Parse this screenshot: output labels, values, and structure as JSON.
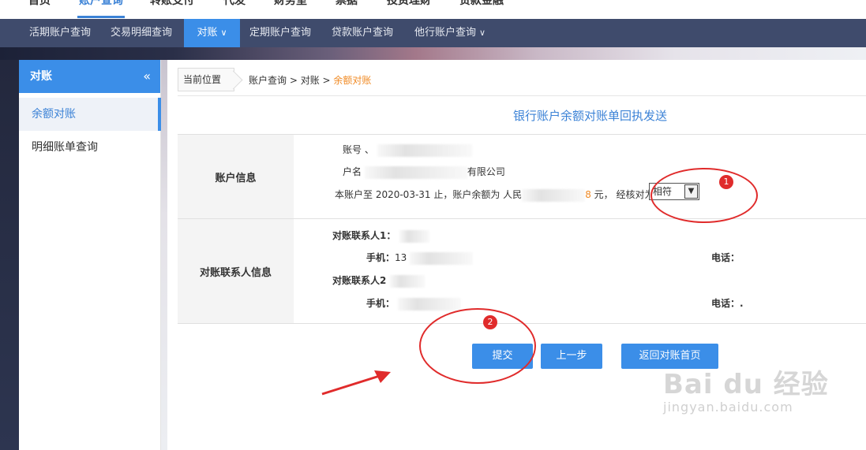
{
  "top_nav": {
    "items": [
      "首页",
      "账户查询",
      "转账支付",
      "代发",
      "财务室",
      "票据",
      "投资理财",
      "贷款金融"
    ],
    "active_index": 1
  },
  "sub_nav": {
    "items": [
      {
        "label": "活期账户查询"
      },
      {
        "label": "交易明细查询"
      },
      {
        "label": "对账",
        "has_dropdown": true,
        "active": true
      },
      {
        "label": "定期账户查询"
      },
      {
        "label": "贷款账户查询"
      },
      {
        "label": "他行账户查询",
        "has_dropdown": true
      }
    ]
  },
  "sidebar": {
    "title": "对账",
    "collapse_icon": "«",
    "items": [
      {
        "label": "余额对账",
        "active": true
      },
      {
        "label": "明细账单查询"
      }
    ]
  },
  "breadcrumb": {
    "here_label": "当前位置",
    "path": "账户查询 > 对账 > ",
    "current": "余额对账"
  },
  "page_title": "银行账户余额对账单回执发送",
  "account_info": {
    "label": "账户信息",
    "account_no_label": "账号",
    "account_no_prefix": "、",
    "name_label": "户名",
    "name_suffix": "有限公司",
    "statement_prefix": "本账户至 2020-03-31 止，账户余额为 人民",
    "balance_tail": "8",
    "statement_suffix": " 元， 经核对为",
    "match_value": "相符"
  },
  "contact_info": {
    "label": "对账联系人信息",
    "contact1_label": "对账联系人1：",
    "mobile_label": "手机：",
    "mobile1_prefix": "13",
    "phone_label": "电话：",
    "contact2_label": "对账联系人2",
    "phone2_value": "."
  },
  "buttons": {
    "submit": "提交",
    "prev": "上一步",
    "back_home": "返回对账首页"
  },
  "annotations": {
    "one": "1",
    "two": "2"
  },
  "watermark": {
    "logo": "Bai du 经验",
    "url": "jingyan.baidu.com"
  },
  "colors": {
    "accent": "#3b8ee8",
    "nav_bg": "#3f4b6c",
    "highlight": "#f08a24",
    "annotation": "#e02b2b"
  }
}
